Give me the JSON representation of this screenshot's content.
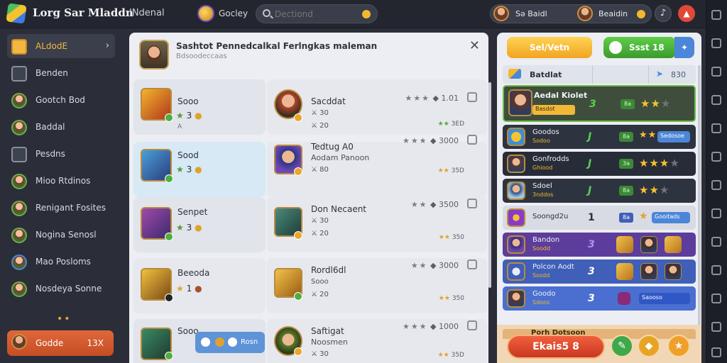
{
  "app": {
    "title": "Lorg Sar Mladdn",
    "top_tab": "INdenal",
    "coins_label": "Gocley",
    "search_placeholder": "Dectiond",
    "user_a": "Sə Baidl",
    "user_b": "Beaidin",
    "music_icon": "music-note-icon",
    "alert_icon": "bell-icon"
  },
  "sidebar": {
    "items": [
      {
        "label": "ALdodE",
        "icon": "inbox-icon",
        "active": true
      },
      {
        "label": "Benden",
        "icon": "check-square-icon"
      },
      {
        "label": "Gootch Bod",
        "icon": "hero-avatar-icon"
      },
      {
        "label": "Baddal",
        "icon": "hero-avatar-icon"
      },
      {
        "label": "Pesdns",
        "icon": "folder-icon"
      },
      {
        "label": "Mioo Rtdinos",
        "icon": "hero-avatar-icon"
      },
      {
        "label": "Renigant Fosites",
        "icon": "hero-avatar-icon"
      },
      {
        "label": "Nogina Senosl",
        "icon": "hero-avatar-icon"
      },
      {
        "label": "Mao Posloms",
        "icon": "hero-avatar-icon"
      },
      {
        "label": "Nosdeya Sonne",
        "icon": "hero-avatar-icon"
      }
    ],
    "footer_label": "Godde",
    "footer_value": "13X"
  },
  "modal": {
    "title": "Sashtot Pennedcalkal Ferlngkas maleman",
    "subtitle": "Bdsoodeccaas",
    "rows": [
      {
        "left": {
          "name": "Sooo",
          "stars": "3",
          "coins": "3",
          "extra": "A",
          "hl": false
        },
        "right": {
          "name": "Sacddat",
          "m1": "30",
          "m2": "20",
          "rating": "1.01",
          "small": "3ED"
        }
      },
      {
        "left": {
          "name": "Sood",
          "stars": "3",
          "coins": "3",
          "extra": "",
          "hl": true
        },
        "right": {
          "name": "Tedtug A0",
          "sub": "Aodam Panoon",
          "m1": "80",
          "rating": "3000",
          "small": "35D"
        }
      },
      {
        "left": {
          "name": "Senpet",
          "stars": "3",
          "coins": "3",
          "extra": "",
          "hl": false
        },
        "right": {
          "name": "Don Necaent",
          "m1": "30",
          "m2": "20",
          "rating": "3500",
          "small": "350"
        }
      },
      {
        "left": {
          "name": "Beeoda",
          "stars": "1",
          "coins": "3",
          "extra": "",
          "hl": false
        },
        "right": {
          "name": "Rordl6dl",
          "m1": "Sooo",
          "m2": "20",
          "rating": "3000",
          "small": "350"
        }
      },
      {
        "left": {
          "name": "Sooo",
          "stars": "3",
          "coins": "3",
          "extra": "",
          "hl": false
        },
        "right": {
          "name": "Saftigat",
          "sub": "Noosmen",
          "m1": "30",
          "rating": "1000",
          "small": "35D"
        }
      }
    ],
    "chip_label": "Rosn"
  },
  "rpanel": {
    "btn_yellow": "Sel/Vetn",
    "btn_green": "Ssst 18",
    "header_title": "Batdlat",
    "header_value": "830",
    "rows": [
      {
        "name": "Aedal Kiolet",
        "sub": "Basdot",
        "rank": "3",
        "chip": "8a",
        "stars": 3,
        "variant": "top"
      },
      {
        "name": "Goodos",
        "sub": "Sodoo",
        "rank": "J",
        "chip": "8a",
        "pill": "Sedosoe",
        "variant": "dark"
      },
      {
        "name": "Gonfrodds",
        "sub": "Ghiood",
        "rank": "J",
        "chip": "3a",
        "stars": 3,
        "variant": "darker"
      },
      {
        "name": "Sdoel",
        "sub": "3nddos",
        "rank": "J",
        "chip": "8a",
        "stars": 3,
        "variant": "dark"
      },
      {
        "name": "Soongd2u",
        "rank": "1",
        "chip": "8a",
        "pill": "Gooitads",
        "variant": "lite"
      },
      {
        "name": "Bandon",
        "sub": "Soodd",
        "rank": "3",
        "variant": "purple"
      },
      {
        "name": "Polcon Aodt",
        "sub": "Sosdd",
        "rank": "3",
        "variant": "blue"
      },
      {
        "name": "Goodo",
        "sub": "Sdoos",
        "rank": "3",
        "pill": "Saooso",
        "variant": "blue"
      }
    ],
    "footer_strip": "Porh Dotsoon",
    "big_button": "Ekais5 8"
  }
}
